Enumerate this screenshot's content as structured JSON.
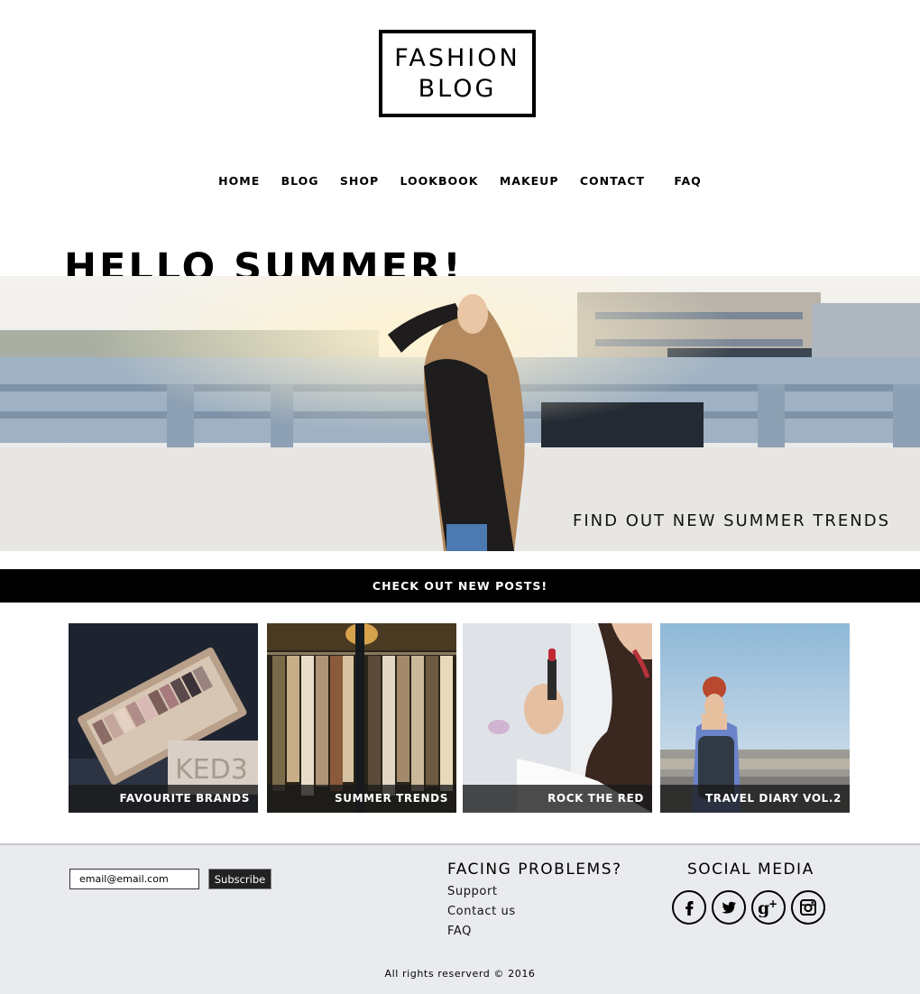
{
  "logo": {
    "line1": "FASHION",
    "line2": "BLOG"
  },
  "nav": {
    "items": [
      "HOME",
      "BLOG",
      "SHOP",
      "LOOKBOOK",
      "MAKEUP",
      "CONTACT",
      "FAQ"
    ]
  },
  "hero": {
    "title": "HELLO SUMMER!",
    "cta": "FIND OUT NEW SUMMER TRENDS"
  },
  "banner": {
    "label": "CHECK OUT NEW POSTS!"
  },
  "posts": [
    {
      "title": "FAVOURITE BRANDS"
    },
    {
      "title": "SUMMER TRENDS"
    },
    {
      "title": "ROCK THE RED"
    },
    {
      "title": "TRAVEL DIARY VOL.2"
    }
  ],
  "footer": {
    "email_placeholder": "email@email.com",
    "subscribe_label": "Subscribe",
    "help_title": "FACING PROBLEMS?",
    "help_links": [
      "Support",
      "Contact us",
      "FAQ"
    ],
    "social_title": "SOCIAL MEDIA",
    "social_icons": [
      "facebook-icon",
      "twitter-icon",
      "google-plus-icon",
      "instagram-icon"
    ],
    "copyright": "All rights reserverd © 2016"
  }
}
